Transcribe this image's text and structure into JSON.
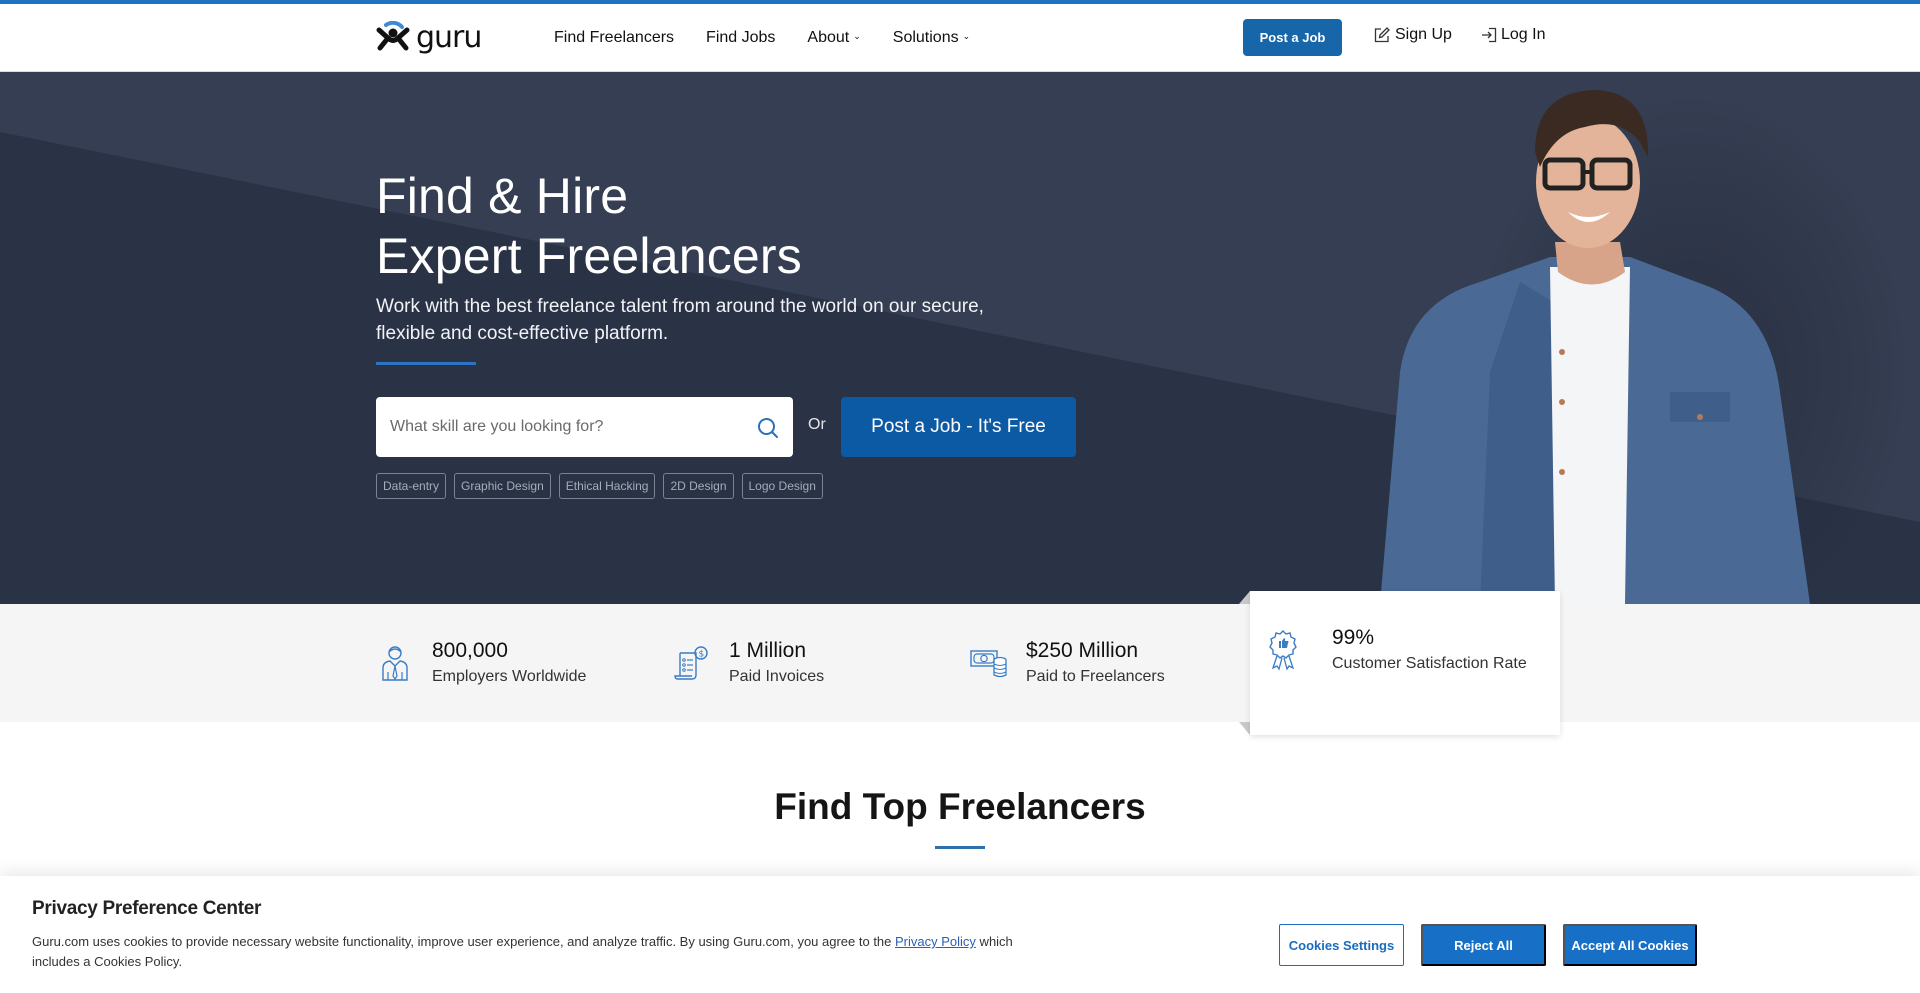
{
  "brand": {
    "name": "guru",
    "accent_color": "#1f72c1",
    "primary_button_color": "#1766aa"
  },
  "header": {
    "nav": [
      {
        "label": "Find Freelancers",
        "has_dropdown": false
      },
      {
        "label": "Find Jobs",
        "has_dropdown": false
      },
      {
        "label": "About",
        "has_dropdown": true
      },
      {
        "label": "Solutions",
        "has_dropdown": true
      }
    ],
    "post_job_label": "Post a Job",
    "sign_up_label": "Sign Up",
    "log_in_label": "Log In",
    "chevron_glyph": "⌄"
  },
  "hero": {
    "title_line1": "Find & Hire",
    "title_line2": "Expert Freelancers",
    "subtitle": "Work with the best freelance talent from around the world on our secure, flexible and cost-effective platform.",
    "search_placeholder": "What skill are you looking for?",
    "or_label": "Or",
    "post_job_free_label": "Post a Job - It's Free",
    "tags": [
      "Data-entry",
      "Graphic Design",
      "Ethical Hacking",
      "2D Design",
      "Logo Design"
    ],
    "background_color": "#2a3246"
  },
  "stats": [
    {
      "icon": "employer-icon",
      "number": "800,000",
      "label": "Employers Worldwide"
    },
    {
      "icon": "invoice-icon",
      "number": "1 Million",
      "label": "Paid Invoices"
    },
    {
      "icon": "money-icon",
      "number": "$250 Million",
      "label": "Paid to Freelancers"
    },
    {
      "icon": "award-icon",
      "number": "99%",
      "label": "Customer Satisfaction Rate"
    }
  ],
  "section": {
    "title": "Find Top Freelancers"
  },
  "cookie_banner": {
    "title": "Privacy Preference Center",
    "text_before_link": "Guru.com uses cookies to provide necessary website functionality, improve user experience, and analyze traffic. By using Guru.com, you agree to the ",
    "link_text": "Privacy Policy",
    "text_after_link": " which includes a Cookies Policy.",
    "settings_label": "Cookies Settings",
    "reject_label": "Reject All",
    "accept_label": "Accept All Cookies"
  }
}
